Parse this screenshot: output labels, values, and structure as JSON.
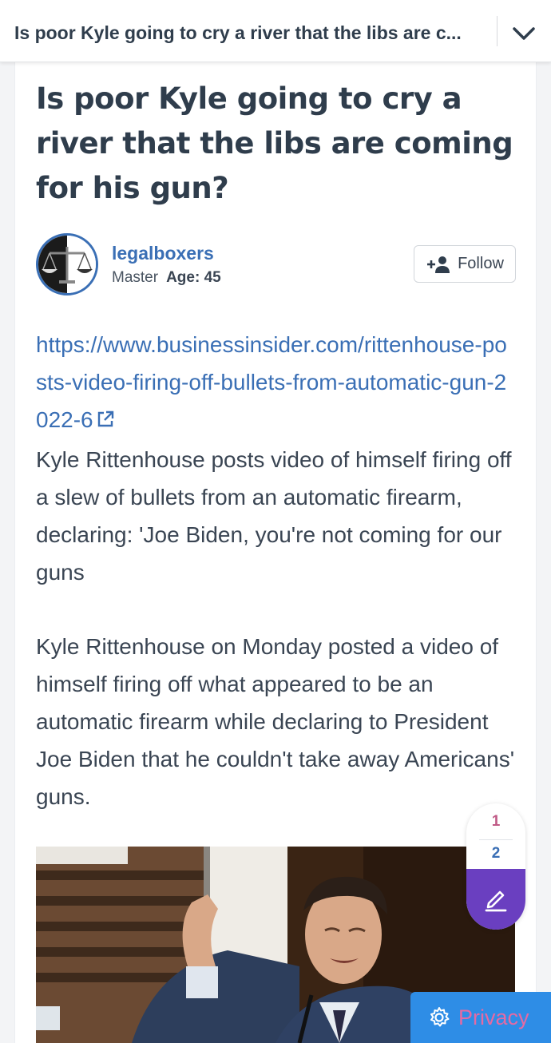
{
  "header": {
    "title": "Is poor Kyle going to cry a river that the libs are c...",
    "expand_icon": "chevron-down-icon"
  },
  "question": {
    "title": "Is poor Kyle going to cry a river that the libs are coming for his gun?"
  },
  "author": {
    "username": "legalboxers",
    "rank": "Master",
    "age_label": "Age: 45",
    "avatar_icon": "scales-of-justice-icon"
  },
  "follow": {
    "label": "Follow",
    "icon": "add-user-icon"
  },
  "content": {
    "link_text": "https://www.businessinsider.com/rittenhouse-posts-video-firing-off-bullets-from-automatic-gun-2022-6",
    "paragraph_1": "Kyle Rittenhouse posts video of himself firing off a slew of bullets from an automatic firearm, declaring: 'Joe Biden, you're not coming for our guns",
    "paragraph_2": "Kyle Rittenhouse on Monday posted a video of himself firing off what appeared to be an automatic firearm while declaring to President Joe Biden that he couldn't take away Americans' guns."
  },
  "pager": {
    "page_1": "1",
    "page_2": "2",
    "edit_icon": "pencil-icon"
  },
  "privacy": {
    "label": "Privacy",
    "icon": "gear-icon"
  },
  "colors": {
    "link": "#3a6fb5",
    "accent_purple": "#6a3fc0",
    "privacy_bg": "#2e8de6",
    "privacy_text": "#e56aa3"
  }
}
